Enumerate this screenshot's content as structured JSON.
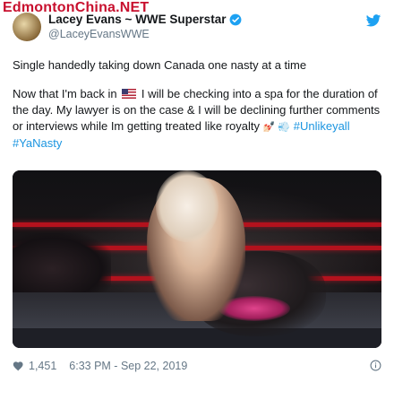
{
  "watermark": "EdmontonChina.NET",
  "tweet": {
    "display_name": "Lacey Evans ~ WWE Superstar",
    "handle": "@LaceyEvansWWE",
    "text_line1": "Single handedly taking down Canada one nasty at a time",
    "para2_before_flag": "Now that I'm back in",
    "para2_after_flag": "I will be checking into a spa for the duration of the day. My lawyer is on the case & I will be declining further comments or interviews while Im getting treated like royalty",
    "emojis": "💅🏻 💨",
    "hashtag1": "#Unlikeyall",
    "hashtag2": "#YaNasty",
    "likes": "1,451",
    "timestamp": "6:33 PM - Sep 22, 2019"
  },
  "colors": {
    "link": "#1b95e0",
    "muted": "#657786",
    "verified": "#1da1f2",
    "rope": "#b3121d"
  },
  "icons": [
    "verified-badge-icon",
    "twitter-bird-icon",
    "heart-icon",
    "info-icon",
    "us-flag-icon"
  ]
}
